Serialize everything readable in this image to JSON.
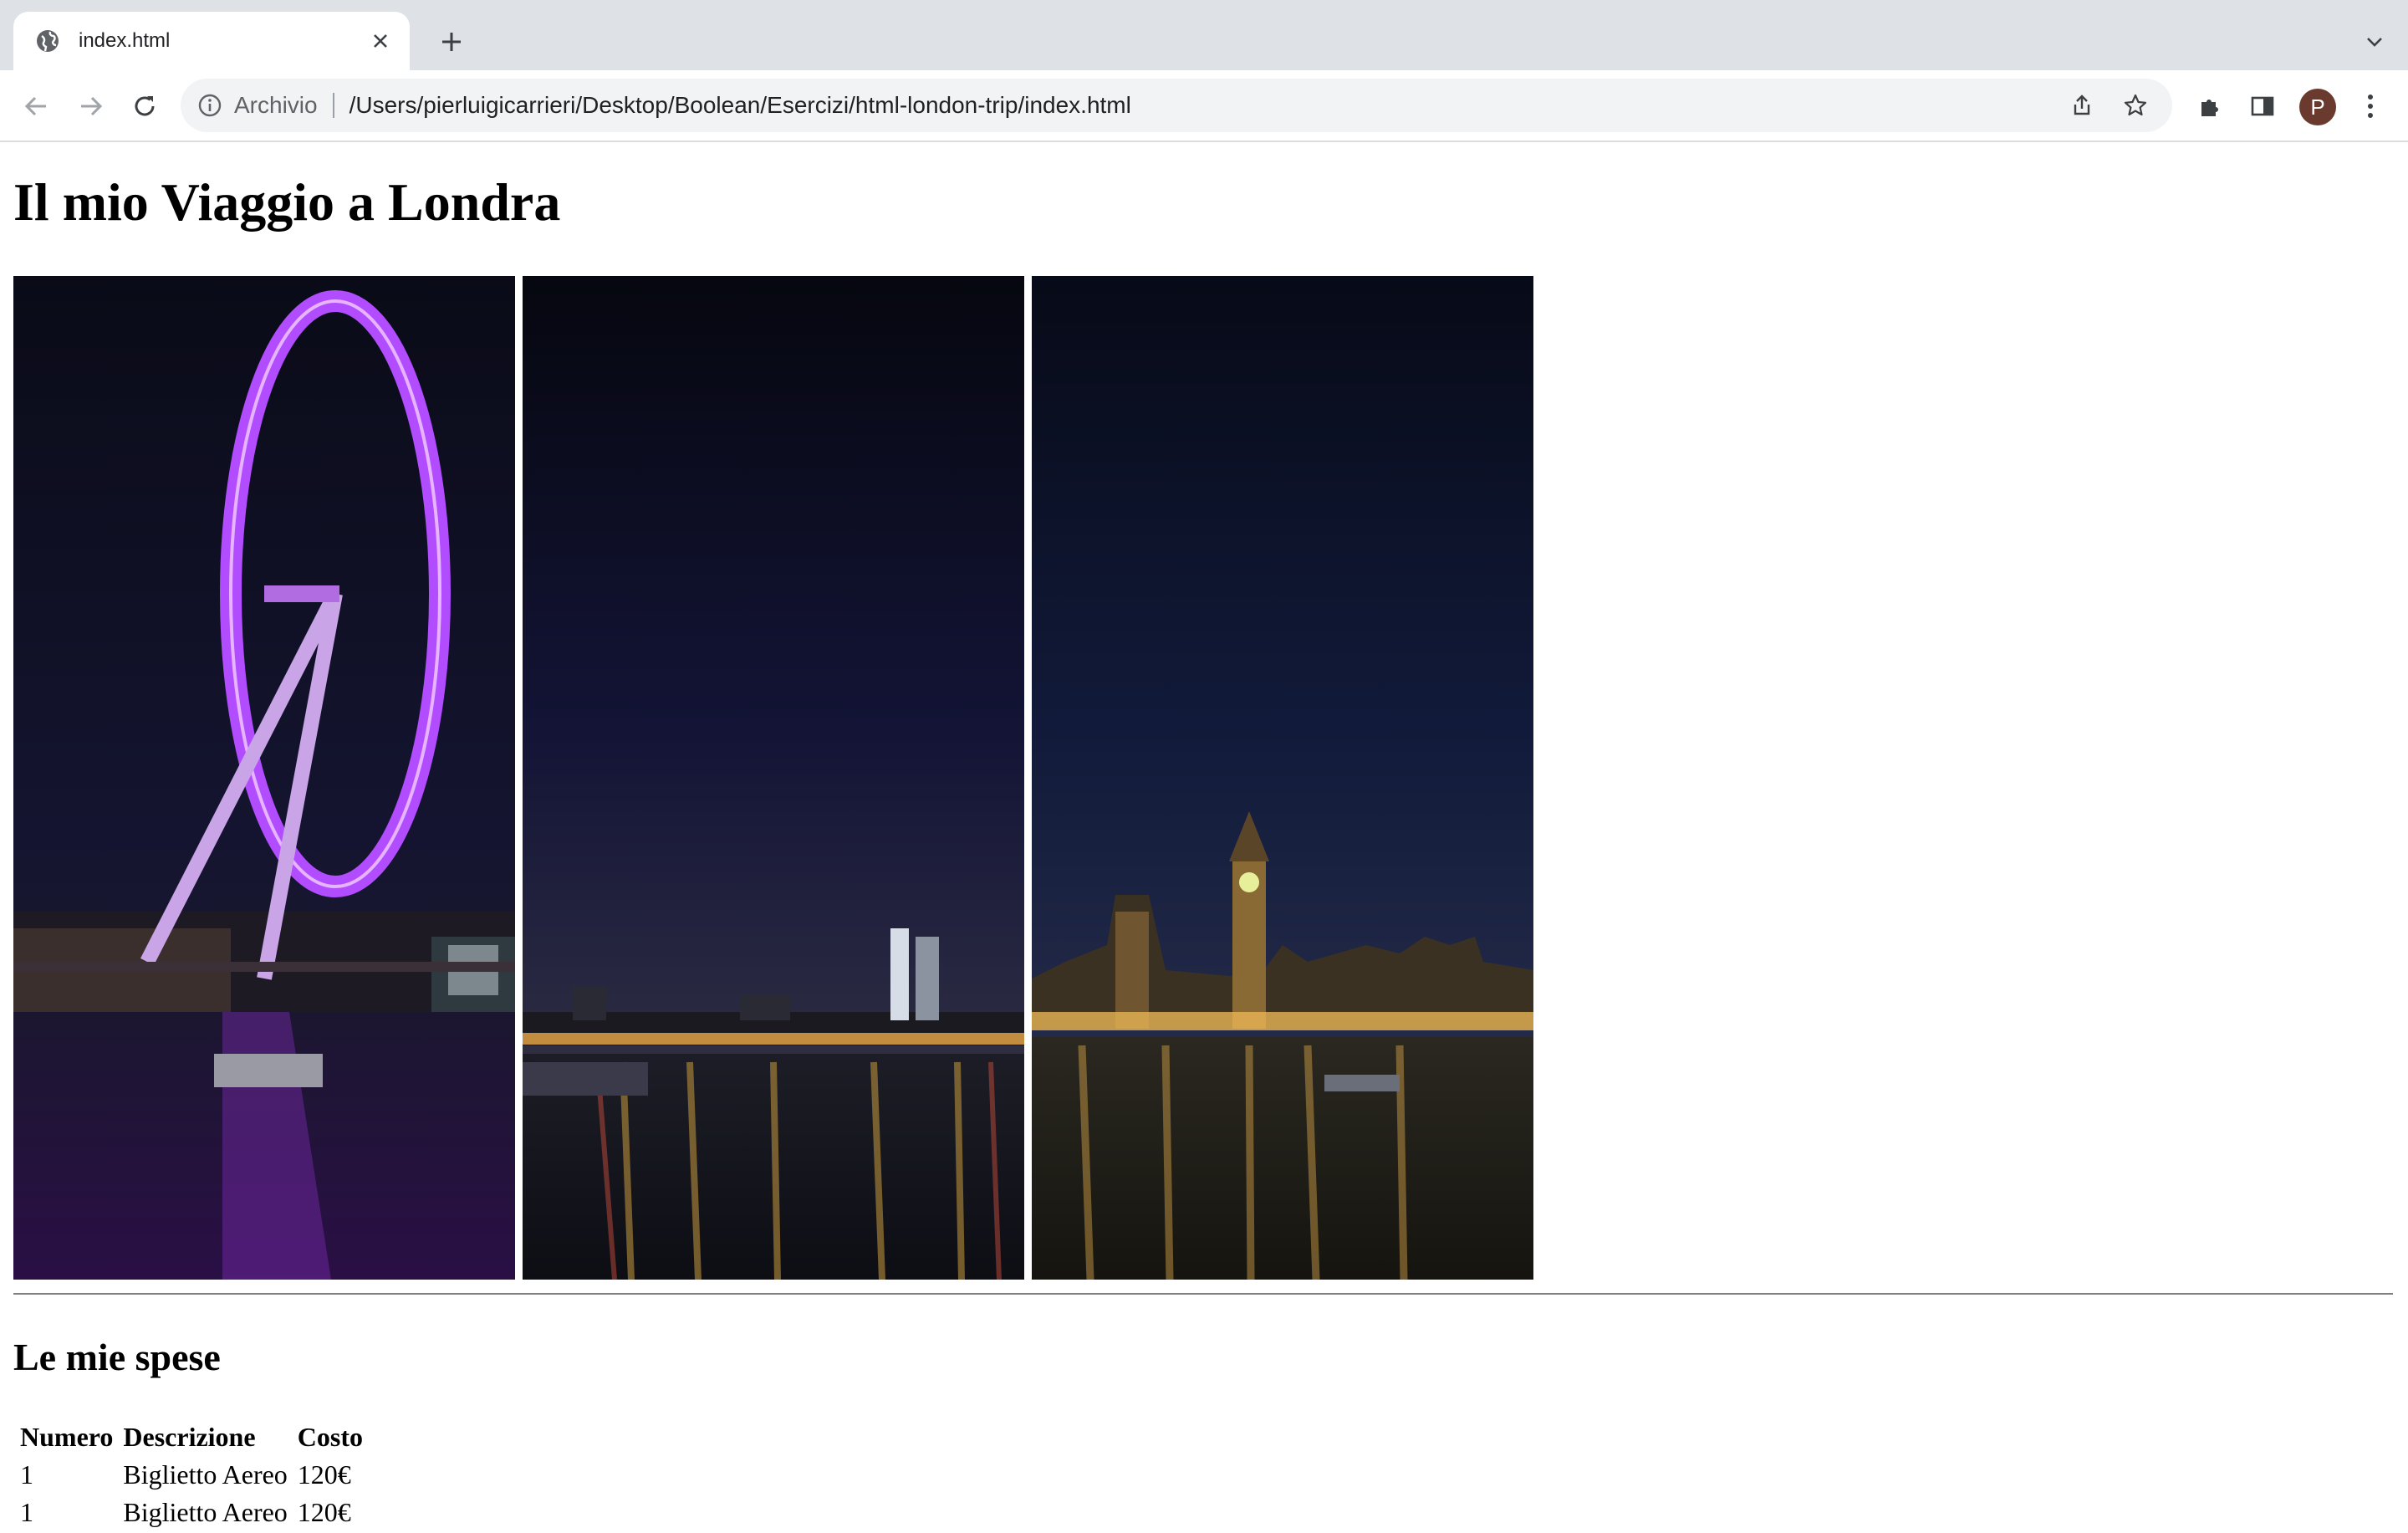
{
  "browser": {
    "tab": {
      "title": "index.html",
      "icon": "globe-icon"
    },
    "new_tab_icon": "plus-icon",
    "tab_search_icon": "chevron-down-icon",
    "nav": {
      "back_icon": "arrow-left-icon",
      "forward_icon": "arrow-right-icon",
      "reload_icon": "reload-icon"
    },
    "address": {
      "info_icon": "info-icon",
      "scheme_label": "Archivio",
      "url": "/Users/pierluigicarrieri/Desktop/Boolean/Esercizi/html-london-trip/index.html"
    },
    "toolbar_icons": [
      "share-icon",
      "star-icon",
      "puzzle-icon",
      "side-panel-icon",
      "kebab-menu-icon"
    ],
    "profile_initial": "P",
    "profile_color": "#6b3a2e"
  },
  "page": {
    "title": "Il mio Viaggio a Londra",
    "photos": [
      {
        "subject": "London Eye at night"
      },
      {
        "subject": "Thames river skyline at night"
      },
      {
        "subject": "Big Ben and Westminster at night"
      }
    ],
    "expenses": {
      "heading": "Le mie spese",
      "columns": [
        "Numero",
        "Descrizione",
        "Costo"
      ],
      "rows": [
        [
          "1",
          "Biglietto Aereo",
          "120€"
        ],
        [
          "1",
          "Biglietto Aereo",
          "120€"
        ]
      ]
    }
  }
}
